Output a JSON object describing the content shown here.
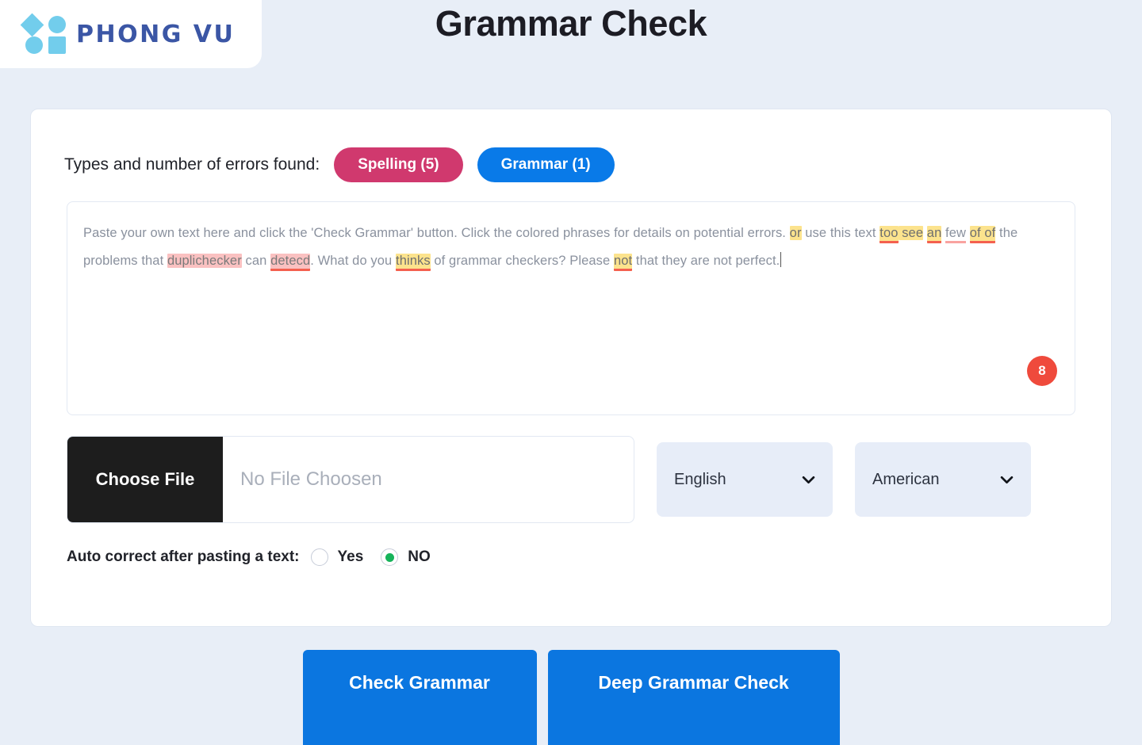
{
  "header": {
    "logo_text": "PHONG VU",
    "title": "Grammar Check"
  },
  "card": {
    "errors_label": "Types and number of errors found:",
    "badges": [
      {
        "label": "Spelling (5)",
        "color": "#d0396e",
        "name": "spelling"
      },
      {
        "label": "Grammar (1)",
        "color": "#097ae8",
        "name": "grammar"
      }
    ],
    "editor": {
      "segments": [
        {
          "text": "Paste your own text here and click the 'Check Grammar' button. Click the colored phrases for details on potential errors. ",
          "style": "plain"
        },
        {
          "text": "or",
          "style": "yellow"
        },
        {
          "text": " use this text ",
          "style": "plain"
        },
        {
          "text": "too",
          "style": "yellow-underline-red"
        },
        {
          "text": " see",
          "style": "yellow"
        },
        {
          "text": " ",
          "style": "plain"
        },
        {
          "text": "an",
          "style": "yellow-underline-red"
        },
        {
          "text": " ",
          "style": "plain"
        },
        {
          "text": "few",
          "style": "underline-pink"
        },
        {
          "text": " ",
          "style": "plain"
        },
        {
          "text": "of of",
          "style": "yellow-underline-red"
        },
        {
          "text": " the problems that ",
          "style": "plain"
        },
        {
          "text": "duplichecker",
          "style": "pink"
        },
        {
          "text": " can ",
          "style": "plain"
        },
        {
          "text": "detecd",
          "style": "pink-underline-red"
        },
        {
          "text": ". What do you ",
          "style": "plain"
        },
        {
          "text": "thinks",
          "style": "yellow-underline-red"
        },
        {
          "text": " of grammar checkers? Please ",
          "style": "plain"
        },
        {
          "text": "not",
          "style": "yellow-underline-red"
        },
        {
          "text": " that they are not perfect.",
          "style": "plain"
        }
      ],
      "count_badge": "8"
    },
    "file_upload": {
      "button_label": "Choose File",
      "file_name_placeholder": "No File Choosen"
    },
    "selects": [
      {
        "name": "language",
        "value": "English"
      },
      {
        "name": "variant",
        "value": "American"
      }
    ],
    "autocorrect": {
      "label": "Auto correct after pasting a text:",
      "options": [
        {
          "label": "Yes",
          "selected": false
        },
        {
          "label": "NO",
          "selected": true
        }
      ],
      "selected_dot_color": "#16b35a"
    }
  },
  "actions": [
    {
      "label": "Check Grammar",
      "name": "check-grammar"
    },
    {
      "label": "Deep Grammar Check",
      "name": "deep-grammar-check"
    }
  ],
  "theme": {
    "page_background": "#e8eef7",
    "primary_blue": "#0b76e0",
    "spelling_pink": "#d0396e",
    "badge_red": "#ef4a3c",
    "logo_blue": "#3b56a5",
    "logo_shape_blue": "#72cdec"
  }
}
